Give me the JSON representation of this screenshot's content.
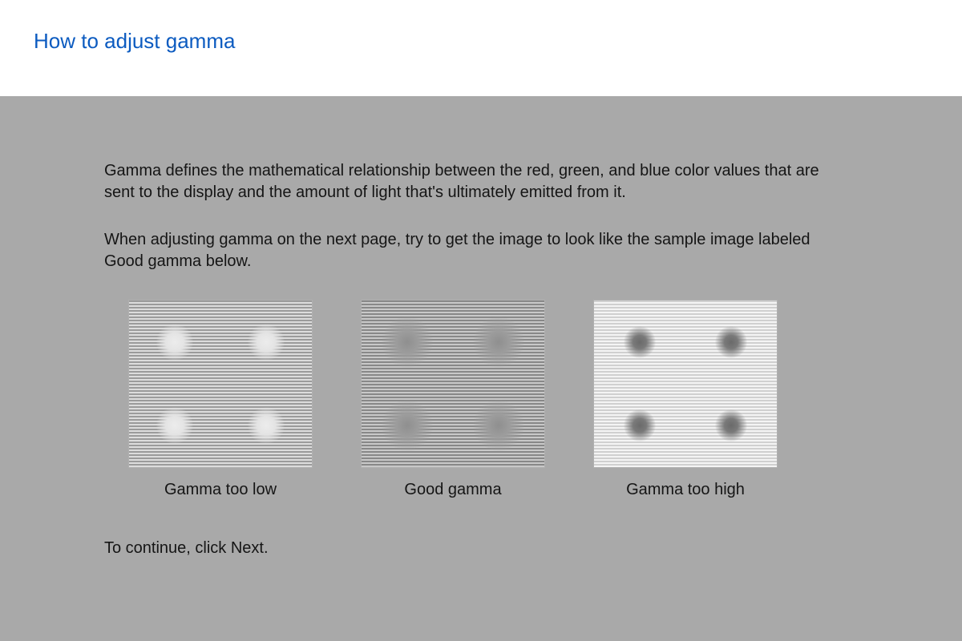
{
  "header": {
    "title": "How to adjust gamma"
  },
  "main": {
    "description1": "Gamma defines the mathematical relationship between the red, green, and blue color values that are sent to the display and the amount of light that's ultimately emitted from it.",
    "description2": "When adjusting gamma on the next page, try to get the image to look like the sample image labeled Good gamma below.",
    "samples": {
      "low": {
        "label": "Gamma too low"
      },
      "good": {
        "label": "Good gamma"
      },
      "high": {
        "label": "Gamma too high"
      }
    },
    "continue_text": "To continue, click Next."
  }
}
